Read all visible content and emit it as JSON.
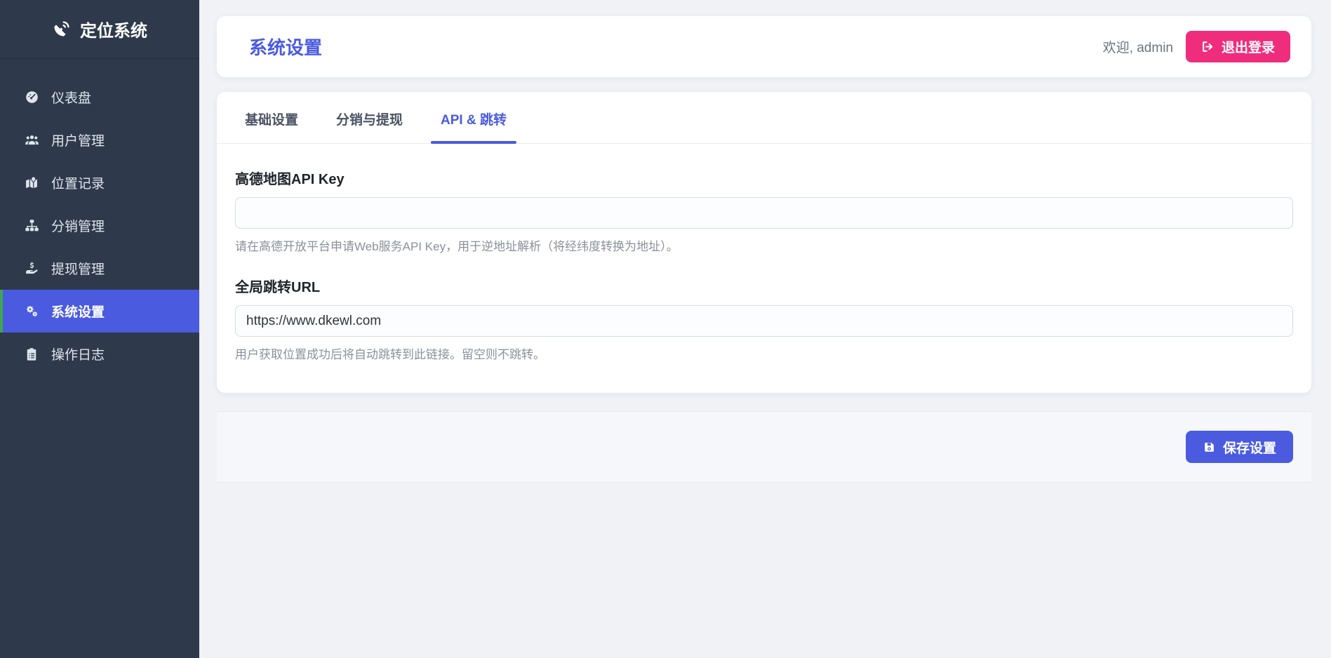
{
  "app": {
    "name": "定位系统"
  },
  "sidebar": {
    "items": [
      {
        "label": "仪表盘"
      },
      {
        "label": "用户管理"
      },
      {
        "label": "位置记录"
      },
      {
        "label": "分销管理"
      },
      {
        "label": "提现管理"
      },
      {
        "label": "系统设置",
        "active": true
      },
      {
        "label": "操作日志"
      }
    ]
  },
  "header": {
    "title": "系统设置",
    "welcome": "欢迎, admin",
    "logout_label": "退出登录"
  },
  "tabs": {
    "items": [
      {
        "label": "基础设置"
      },
      {
        "label": "分销与提现"
      },
      {
        "label": "API & 跳转",
        "active": true
      }
    ]
  },
  "settings_form": {
    "amap_key": {
      "label": "高德地图API Key",
      "value": "",
      "help": "请在高德开放平台申请Web服务API Key，用于逆地址解析（将经纬度转换为地址）。"
    },
    "redirect_url": {
      "label": "全局跳转URL",
      "value": "https://www.dkewl.com",
      "help": "用户获取位置成功后将自动跳转到此链接。留空则不跳转。"
    },
    "save_label": "保存设置"
  },
  "colors": {
    "primary": "#4a5be0",
    "logout_pink": "#f02d7d",
    "sidebar_bg": "#2e3a4b",
    "active_item_stripe": "#3fa650",
    "page_bg": "#f0f2f6"
  }
}
